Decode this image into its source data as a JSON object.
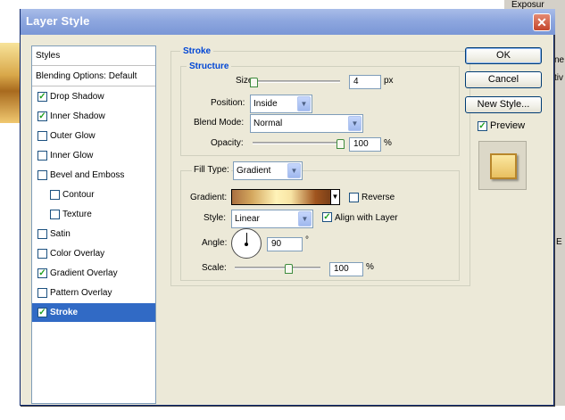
{
  "background": {
    "right_panel_texts": [
      "Exposur",
      "Sat",
      "ne",
      "tiv",
      "E"
    ]
  },
  "dialog": {
    "title": "Layer Style",
    "close_glyph": "✕"
  },
  "styles": {
    "header": "Styles",
    "blending": "Blending Options: Default",
    "items": [
      {
        "label": "Drop Shadow",
        "checked": true
      },
      {
        "label": "Inner Shadow",
        "checked": true
      },
      {
        "label": "Outer Glow",
        "checked": false
      },
      {
        "label": "Inner Glow",
        "checked": false
      },
      {
        "label": "Bevel and Emboss",
        "checked": false
      },
      {
        "label": "Contour",
        "checked": false
      },
      {
        "label": "Texture",
        "checked": false
      },
      {
        "label": "Satin",
        "checked": false
      },
      {
        "label": "Color Overlay",
        "checked": false
      },
      {
        "label": "Gradient Overlay",
        "checked": true
      },
      {
        "label": "Pattern Overlay",
        "checked": false
      },
      {
        "label": "Stroke",
        "checked": true
      }
    ]
  },
  "stroke": {
    "title": "Stroke",
    "structure": {
      "title": "Structure",
      "size_label": "Size:",
      "size_value": "4",
      "size_unit": "px",
      "position_label": "Position:",
      "position_value": "Inside",
      "blend_label": "Blend Mode:",
      "blend_value": "Normal",
      "opacity_label": "Opacity:",
      "opacity_value": "100",
      "opacity_unit": "%"
    },
    "fill": {
      "fill_type_label": "Fill Type:",
      "fill_type_value": "Gradient",
      "gradient_label": "Gradient:",
      "reverse_label": "Reverse",
      "reverse_checked": false,
      "style_label": "Style:",
      "style_value": "Linear",
      "align_label": "Align with Layer",
      "align_checked": true,
      "angle_label": "Angle:",
      "angle_value": "90",
      "angle_unit": "°",
      "scale_label": "Scale:",
      "scale_value": "100",
      "scale_unit": "%"
    }
  },
  "buttons": {
    "ok": "OK",
    "cancel": "Cancel",
    "new_style": "New Style...",
    "preview": "Preview",
    "preview_checked": true
  },
  "check_glyph": "✓",
  "dropdown_glyph": "▼"
}
